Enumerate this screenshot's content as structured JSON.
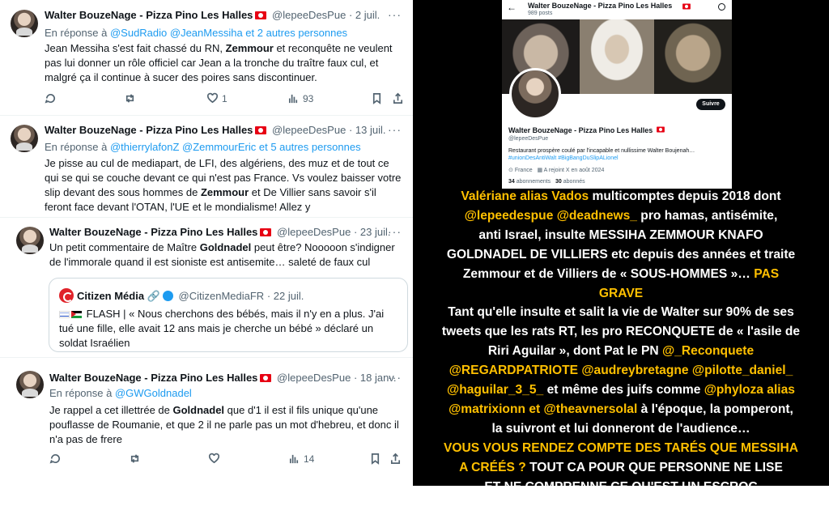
{
  "tweets": [
    {
      "name": "Walter BouzeNage - Pizza Pino Les Halles",
      "handle": "@lepeeDesPue",
      "date": "· 2 juil.",
      "reply_prefix": "En réponse à",
      "reply_links": "@SudRadio @JeanMessiha",
      "reply_more": "et 2 autres personnes",
      "body": [
        [
          "Jean Messiha s'est fait chassé du RN, ",
          "Zemmour",
          " et reconquête ne veulent"
        ],
        [
          "pas lui donner un rôle officiel car Jean a la tronche du traître faux cul, et",
          "",
          ""
        ],
        [
          "malgré ça il continue à sucer des poires sans discontinuer.",
          "",
          ""
        ]
      ],
      "likes": "1",
      "views": "93"
    },
    {
      "name": "Walter BouzeNage - Pizza Pino Les Halles",
      "handle": "@lepeeDesPue",
      "date": "· 13 juil.",
      "reply_prefix": "En réponse à",
      "reply_links": "@thierrylafonZ @ZemmourEric",
      "reply_more": "et 5 autres personnes",
      "body": [
        [
          "Je pisse au cul de mediapart, de LFI, des algériens, des muz et de tout ce",
          "",
          ""
        ],
        [
          "qui se qui se couche devant ce qui n'est pas France. Vs voulez baisser votre",
          "",
          ""
        ],
        [
          "slip devant des sous hommes de ",
          "Zemmour",
          " et De Villier sans savoir s'il"
        ],
        [
          "feront face devant l'OTAN, l'UE et le mondialisme! Allez y",
          "",
          ""
        ]
      ]
    },
    {
      "name": "Walter BouzeNage - Pizza Pino Les Halles",
      "handle": "@lepeeDesPue",
      "date": "· 23 juil.",
      "body": [
        [
          "Un petit commentaire de Maître ",
          "Goldnadel",
          " peut être? Nooooon s'indigner"
        ],
        [
          "de l'immorale quand il est sioniste est antisemite… saleté de faux cul",
          "",
          ""
        ]
      ],
      "quote": {
        "name": "Citizen Média",
        "handle": "@CitizenMediaFR",
        "date": "· 22 juil.",
        "lines": [
          "FLASH | « Nous cherchons des bébés, mais il n'y en a plus. J'ai",
          "tué une fille, elle avait 12 ans mais je cherche un bébé » déclaré un",
          "soldat Israélien"
        ]
      }
    },
    {
      "name": "Walter BouzeNage - Pizza Pino Les Halles",
      "handle": "@lepeeDesPue",
      "date": "· 18 janv.",
      "reply_prefix": "En réponse à",
      "reply_links": "@GWGoldnadel",
      "reply_more": "",
      "body": [
        [
          "Je rappel a cet illettrée de ",
          "Goldnadel",
          " que d'1 il est il fils unique qu'une"
        ],
        [
          "pouflasse de Roumanie, et que 2 il ne parle pas un mot d'hebreu, et donc il",
          "",
          ""
        ],
        [
          "n'a pas de frere",
          "",
          ""
        ]
      ],
      "views": "14"
    }
  ],
  "profile": {
    "back_icon": "←",
    "title": "Walter BouzeNage - Pizza Pino Les Halles",
    "posts": "989 posts",
    "follow": "Suivre",
    "name": "Walter BouzeNage - Pizza Pino Les Halles",
    "handle": "@lepeeDesPue",
    "bio": "Restaurant prospère coulé par l'incapable et nullissime Walter Boujenah…",
    "tags": "#unionDesAntiWalt #BigBangDuSlipALionel",
    "location": "France",
    "joined": "A rejoint X en août 2024",
    "following_count": "34",
    "following_label": "abonnements",
    "followers_count": "30",
    "followers_label": "abonnés"
  },
  "statement": [
    [
      [
        "y",
        "Valériane alias Vados"
      ],
      [
        "w",
        " multicomptes depuis 2018 dont"
      ]
    ],
    [
      [
        "y",
        "@lepeedespue @deadnews_"
      ],
      [
        "w",
        " pro hamas, antisémite,"
      ]
    ],
    [
      [
        "w",
        "anti Israel, insulte MESSIHA ZEMMOUR KNAFO"
      ]
    ],
    [
      [
        "w",
        "GOLDNADEL DE VILLIERS etc depuis des années et traite"
      ]
    ],
    [
      [
        "w",
        "Zemmour et de Villiers de « SOUS-HOMMES »… "
      ],
      [
        "y",
        "PAS"
      ]
    ],
    [
      [
        "y",
        "GRAVE"
      ]
    ],
    [
      [
        "w",
        "Tant qu'elle insulte et salit la vie de Walter sur 90% de ses"
      ]
    ],
    [
      [
        "w",
        "tweets que les rats RT, les pro RECONQUETE de « l'asile de"
      ]
    ],
    [
      [
        "w",
        "Riri Aguilar », dont Pat le PN "
      ],
      [
        "y",
        "@_Reconquete"
      ]
    ],
    [
      [
        "y",
        "@REGARDPATRIOTE @audreybretagne @pilotte_daniel_"
      ]
    ],
    [
      [
        "y",
        "@haguilar_3_5_"
      ],
      [
        "w",
        " et même des juifs comme "
      ],
      [
        "y",
        "@phyloza alias"
      ]
    ],
    [
      [
        "y",
        "@matrixionn et @theavnersolal"
      ],
      [
        "w",
        " à l'époque, la pomperont,"
      ]
    ],
    [
      [
        "w",
        "la suivront et lui donneront de l'audience…"
      ]
    ],
    [
      [
        "y",
        "VOUS VOUS RENDEZ COMPTE DES TARÉS QUE MESSIHA"
      ]
    ],
    [
      [
        "y",
        "A CRÉÉS ?"
      ],
      [
        "w",
        " TOUT CA POUR QUE PERSONNE NE LISE"
      ]
    ],
    [
      [
        "w",
        "ET NE COMPRENNE CE QU'EST UN ESCROC"
      ]
    ]
  ],
  "colors": {
    "accent": "#ffc000",
    "link": "#1d9bf0",
    "muted": "#536471"
  }
}
